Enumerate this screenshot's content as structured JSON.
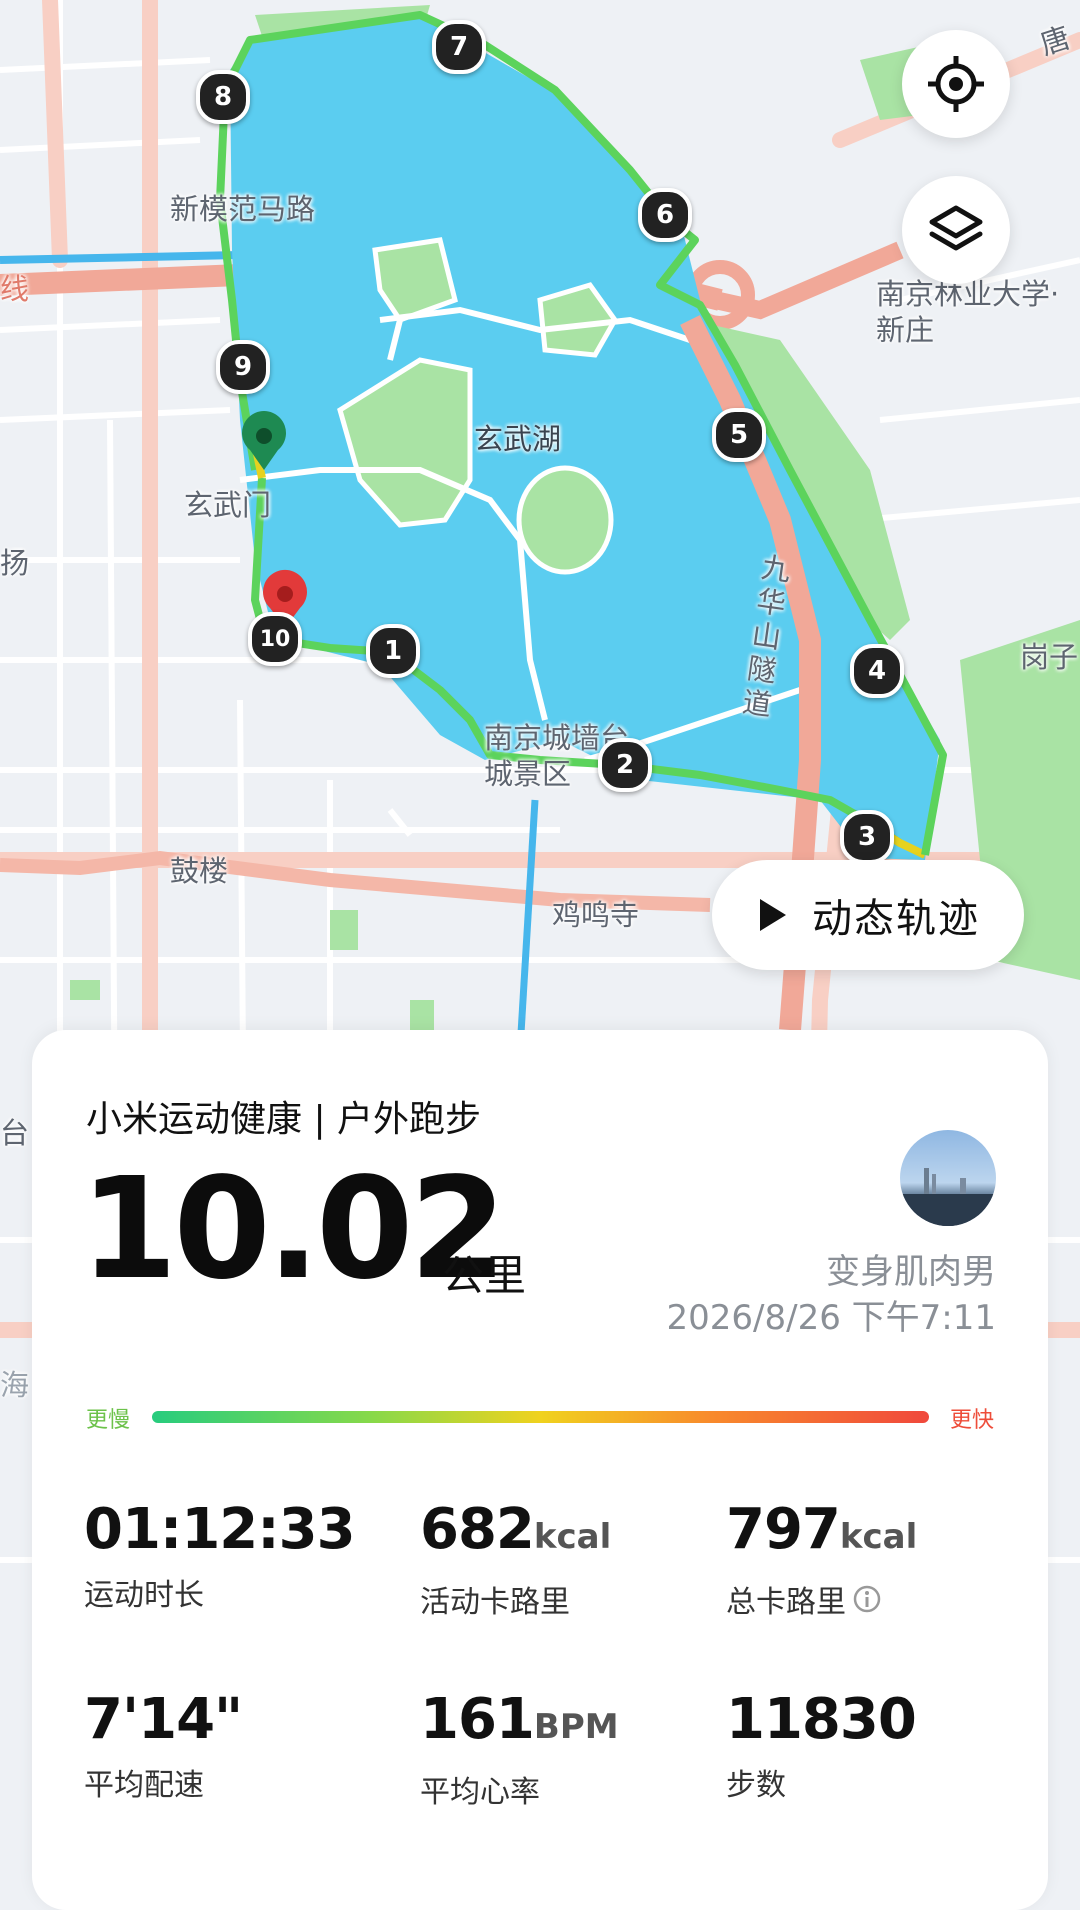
{
  "map": {
    "labels": {
      "xinmofan_road": "新模范马路",
      "xuanwu_gate": "玄武门",
      "xuanwu_lake": "玄武湖",
      "forestry_univ": "南京林业大学·新庄",
      "jiuhuashan_tunnel": "九华山隧道",
      "city_wall": "南京城墙台城景区",
      "gulou": "鼓楼",
      "jiming_temple": "鸡鸣寺",
      "gangzi": "岗子",
      "tang": "唐",
      "xian": "线",
      "yang": "扬",
      "tai": "台",
      "hai": "海"
    },
    "km_markers": [
      "1",
      "2",
      "3",
      "4",
      "5",
      "6",
      "7",
      "8",
      "9",
      "10"
    ],
    "route_colors": {
      "green": "#5cd35c",
      "yellow": "#e6d21e",
      "lake": "#5bcdf0",
      "park": "#a9e3a4"
    }
  },
  "controls": {
    "locate_icon": "crosshair-icon",
    "layers_icon": "layers-icon",
    "dynamic_track_label": "动态轨迹"
  },
  "summary": {
    "title": "小米运动健康 | 户外跑步",
    "distance": "10.02",
    "distance_unit": "公里",
    "username": "变身肌肉男",
    "datetime": "2026/8/26 下午7:11",
    "speed_slow": "更慢",
    "speed_fast": "更快"
  },
  "stats": [
    {
      "value": "01:12:33",
      "unit": "",
      "label": "运动时长"
    },
    {
      "value": "682",
      "unit": "kcal",
      "label": "活动卡路里"
    },
    {
      "value": "797",
      "unit": "kcal",
      "label": "总卡路里"
    },
    {
      "value": "7'14\"",
      "unit": "",
      "label": "平均配速"
    },
    {
      "value": "161",
      "unit": "BPM",
      "label": "平均心率"
    },
    {
      "value": "11830",
      "unit": "",
      "label": "步数"
    }
  ]
}
